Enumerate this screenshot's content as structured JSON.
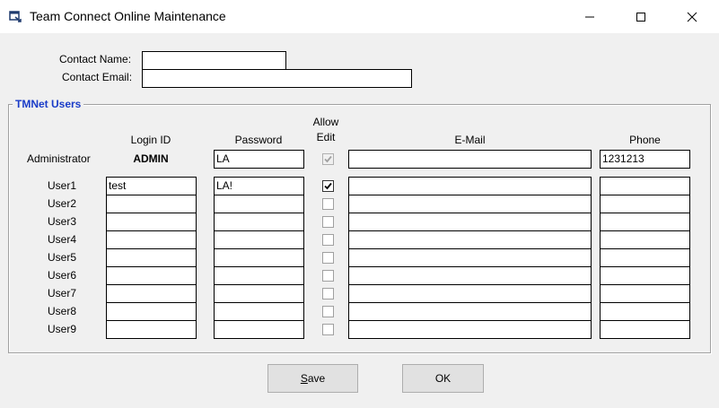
{
  "window": {
    "title": "Team Connect Online Maintenance"
  },
  "contact": {
    "name_label": "Contact Name:",
    "name_value": "",
    "email_label": "Contact Email:",
    "email_value": ""
  },
  "group": {
    "title": "TMNet Users"
  },
  "columns": {
    "login_id": "Login ID",
    "password": "Password",
    "allow_edit_line1": "Allow",
    "allow_edit_line2": "Edit",
    "email": "E-Mail",
    "phone": "Phone"
  },
  "admin": {
    "label": "Administrator",
    "login": "ADMIN",
    "password": "LA",
    "allow_edit": true,
    "email": "",
    "phone": "1231213"
  },
  "users": [
    {
      "label": "User1",
      "login": "test",
      "password": "LA!",
      "allow_edit": true,
      "email": "",
      "phone": ""
    },
    {
      "label": "User2",
      "login": "",
      "password": "",
      "allow_edit": false,
      "email": "",
      "phone": ""
    },
    {
      "label": "User3",
      "login": "",
      "password": "",
      "allow_edit": false,
      "email": "",
      "phone": ""
    },
    {
      "label": "User4",
      "login": "",
      "password": "",
      "allow_edit": false,
      "email": "",
      "phone": ""
    },
    {
      "label": "User5",
      "login": "",
      "password": "",
      "allow_edit": false,
      "email": "",
      "phone": ""
    },
    {
      "label": "User6",
      "login": "",
      "password": "",
      "allow_edit": false,
      "email": "",
      "phone": ""
    },
    {
      "label": "User7",
      "login": "",
      "password": "",
      "allow_edit": false,
      "email": "",
      "phone": ""
    },
    {
      "label": "User8",
      "login": "",
      "password": "",
      "allow_edit": false,
      "email": "",
      "phone": ""
    },
    {
      "label": "User9",
      "login": "",
      "password": "",
      "allow_edit": false,
      "email": "",
      "phone": ""
    }
  ],
  "buttons": {
    "save_mnemonic": "S",
    "save_rest": "ave",
    "ok": "OK"
  },
  "icons": {
    "app": "app-window-icon",
    "minimize": "minimize-icon",
    "maximize": "maximize-icon",
    "close": "close-icon",
    "check": "checkmark-icon"
  },
  "colors": {
    "group_title": "#1a3cc8",
    "window_bg": "#f0f0f0"
  }
}
